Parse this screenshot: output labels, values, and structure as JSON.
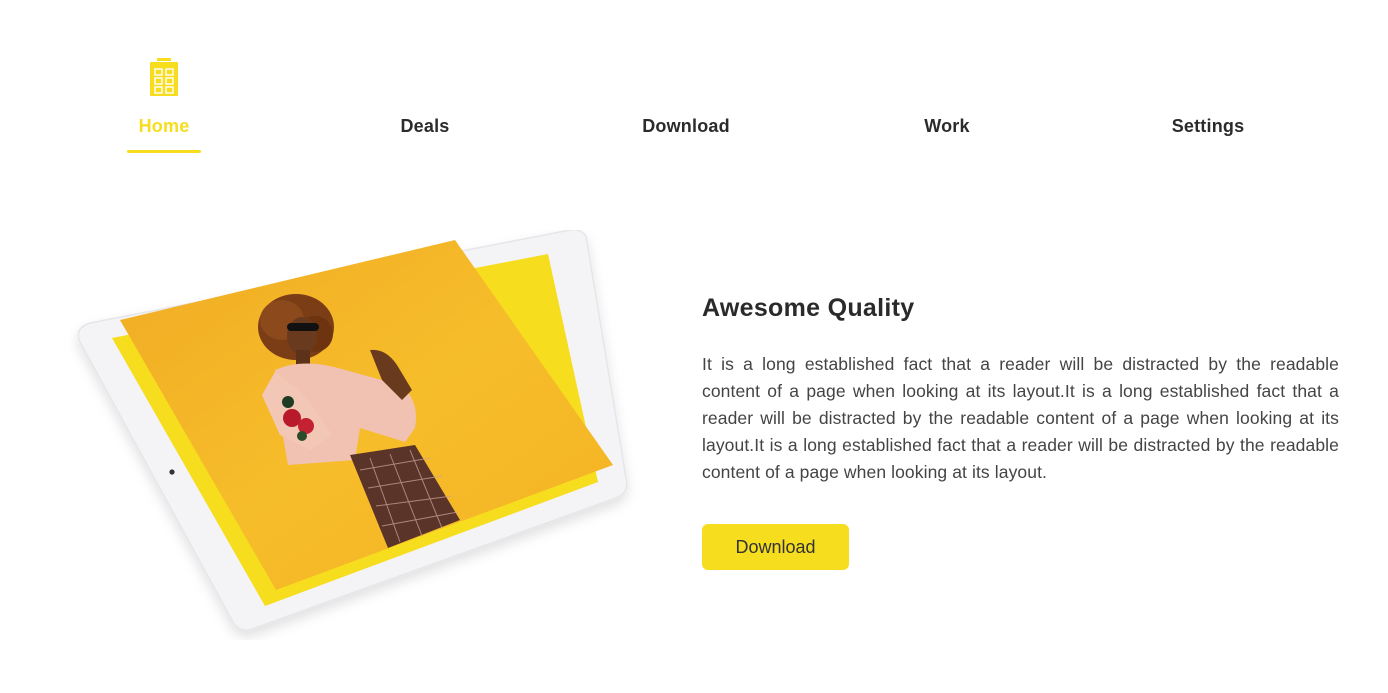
{
  "nav": {
    "items": [
      {
        "label": "Home",
        "active": true,
        "icon": "building-icon"
      },
      {
        "label": "Deals",
        "active": false
      },
      {
        "label": "Download",
        "active": false
      },
      {
        "label": "Work",
        "active": false
      },
      {
        "label": "Settings",
        "active": false
      }
    ]
  },
  "hero": {
    "image": "tablet-photo-woman-yellow-background",
    "heading": "Awesome Quality",
    "body": "It is a long established fact that a reader will be distracted by the readable content of a page when looking at its layout.It is a long established fact that a reader will be distracted by the readable content of a page when looking at its layout.It is a long established fact that a reader will be distracted by the readable content of a page when looking at its layout.",
    "button_label": "Download"
  },
  "colors": {
    "accent": "#f6dd1e",
    "text_dark": "#2b2b2b",
    "text_body": "#444444",
    "photo_bg": "#f3b626"
  }
}
